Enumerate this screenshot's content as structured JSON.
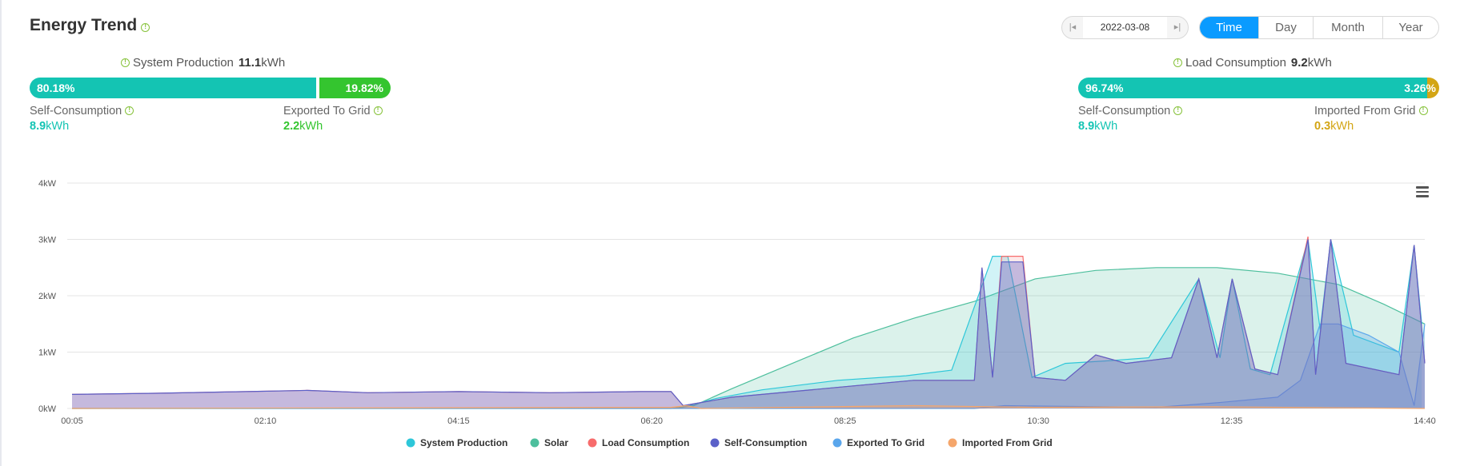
{
  "header": {
    "title": "Energy Trend"
  },
  "controls": {
    "date": "2022-03-08",
    "ranges": [
      {
        "label": "Time",
        "active": true
      },
      {
        "label": "Day",
        "active": false
      },
      {
        "label": "Month",
        "active": false
      },
      {
        "label": "Year",
        "active": false
      }
    ]
  },
  "production": {
    "title": "System Production",
    "total": "11.1",
    "unit": "kWh",
    "self_pct": "80.18%",
    "export_pct": "19.82%",
    "self_fraction": 0.8018,
    "self_label": "Self-Consumption",
    "self_value": "8.9",
    "export_label": "Exported To Grid",
    "export_value": "2.2"
  },
  "consumption": {
    "title": "Load Consumption",
    "total": "9.2",
    "unit": "kWh",
    "self_pct": "96.74%",
    "import_pct": "3.26%",
    "self_fraction": 0.9674,
    "self_label": "Self-Consumption",
    "self_value": "8.9",
    "import_label": "Imported From Grid",
    "import_value": "0.3"
  },
  "colors": {
    "teal": "#14c4b3",
    "green": "#34c52f",
    "gold": "#d3a515",
    "accent_blue": "#0a9bff",
    "info_green": "#86c23a"
  },
  "chart_data": {
    "type": "area",
    "x_ticks": [
      "00:05",
      "02:10",
      "04:15",
      "06:20",
      "08:25",
      "10:30",
      "12:35",
      "14:40"
    ],
    "x_minutes_range": [
      5,
      897
    ],
    "y_ticks": [
      "0kW",
      "1kW",
      "2kW",
      "3kW",
      "4kW"
    ],
    "ylim": [
      0,
      4
    ],
    "grid": true,
    "legend_position": "bottom",
    "series": [
      {
        "name": "System Production",
        "color": "#2ec7d9",
        "points": [
          [
            405,
            0
          ],
          [
            430,
            0.18
          ],
          [
            460,
            0.33
          ],
          [
            510,
            0.5
          ],
          [
            555,
            0.58
          ],
          [
            585,
            0.68
          ],
          [
            612,
            2.7
          ],
          [
            622,
            2.7
          ],
          [
            638,
            0.55
          ],
          [
            660,
            0.8
          ],
          [
            690,
            0.85
          ],
          [
            715,
            0.9
          ],
          [
            748,
            2.3
          ],
          [
            762,
            0.9
          ],
          [
            770,
            2.3
          ],
          [
            782,
            0.7
          ],
          [
            795,
            0.6
          ],
          [
            820,
            3.0
          ],
          [
            828,
            1.4
          ],
          [
            835,
            3.0
          ],
          [
            850,
            1.3
          ],
          [
            880,
            1.0
          ],
          [
            890,
            2.9
          ],
          [
            895,
            1.5
          ]
        ]
      },
      {
        "name": "Solar",
        "color": "#4dbf9d",
        "points": [
          [
            5,
            0
          ],
          [
            400,
            0
          ],
          [
            415,
            0.05
          ],
          [
            440,
            0.35
          ],
          [
            480,
            0.8
          ],
          [
            520,
            1.25
          ],
          [
            560,
            1.6
          ],
          [
            600,
            1.9
          ],
          [
            640,
            2.3
          ],
          [
            680,
            2.45
          ],
          [
            720,
            2.5
          ],
          [
            760,
            2.5
          ],
          [
            800,
            2.4
          ],
          [
            840,
            2.2
          ],
          [
            870,
            1.85
          ],
          [
            897,
            1.5
          ]
        ]
      },
      {
        "name": "Load Consumption",
        "color": "#f76c6c",
        "points": [
          [
            5,
            0.25
          ],
          [
            60,
            0.27
          ],
          [
            120,
            0.3
          ],
          [
            160,
            0.32
          ],
          [
            200,
            0.28
          ],
          [
            260,
            0.3
          ],
          [
            320,
            0.28
          ],
          [
            380,
            0.3
          ],
          [
            400,
            0.3
          ],
          [
            408,
            0.05
          ],
          [
            440,
            0.2
          ],
          [
            480,
            0.3
          ],
          [
            520,
            0.4
          ],
          [
            560,
            0.5
          ],
          [
            600,
            0.5
          ],
          [
            605,
            2.5
          ],
          [
            612,
            0.55
          ],
          [
            618,
            2.7
          ],
          [
            632,
            2.7
          ],
          [
            640,
            0.55
          ],
          [
            660,
            0.5
          ],
          [
            680,
            0.95
          ],
          [
            700,
            0.8
          ],
          [
            730,
            0.9
          ],
          [
            748,
            2.3
          ],
          [
            760,
            0.9
          ],
          [
            770,
            2.3
          ],
          [
            785,
            0.7
          ],
          [
            800,
            0.6
          ],
          [
            820,
            3.05
          ],
          [
            825,
            0.6
          ],
          [
            835,
            3.0
          ],
          [
            845,
            0.8
          ],
          [
            880,
            0.6
          ],
          [
            890,
            2.9
          ],
          [
            897,
            0.8
          ]
        ]
      },
      {
        "name": "Self-Consumption",
        "color": "#5b61c9",
        "points": [
          [
            5,
            0.25
          ],
          [
            60,
            0.27
          ],
          [
            120,
            0.3
          ],
          [
            160,
            0.32
          ],
          [
            200,
            0.28
          ],
          [
            260,
            0.3
          ],
          [
            320,
            0.28
          ],
          [
            380,
            0.3
          ],
          [
            400,
            0.3
          ],
          [
            408,
            0.05
          ],
          [
            440,
            0.2
          ],
          [
            480,
            0.3
          ],
          [
            520,
            0.4
          ],
          [
            560,
            0.5
          ],
          [
            600,
            0.5
          ],
          [
            605,
            2.5
          ],
          [
            612,
            0.55
          ],
          [
            618,
            2.6
          ],
          [
            632,
            2.6
          ],
          [
            640,
            0.55
          ],
          [
            660,
            0.5
          ],
          [
            680,
            0.95
          ],
          [
            700,
            0.8
          ],
          [
            730,
            0.9
          ],
          [
            748,
            2.3
          ],
          [
            760,
            0.9
          ],
          [
            770,
            2.3
          ],
          [
            785,
            0.7
          ],
          [
            800,
            0.6
          ],
          [
            820,
            3.0
          ],
          [
            825,
            0.6
          ],
          [
            835,
            3.0
          ],
          [
            845,
            0.8
          ],
          [
            880,
            0.6
          ],
          [
            890,
            2.9
          ],
          [
            897,
            0.8
          ]
        ]
      },
      {
        "name": "Exported To Grid",
        "color": "#5aa6ec",
        "points": [
          [
            5,
            0
          ],
          [
            600,
            0
          ],
          [
            620,
            0.05
          ],
          [
            720,
            0.02
          ],
          [
            760,
            0.1
          ],
          [
            800,
            0.2
          ],
          [
            815,
            0.5
          ],
          [
            828,
            1.5
          ],
          [
            840,
            1.5
          ],
          [
            860,
            1.3
          ],
          [
            880,
            1.0
          ],
          [
            890,
            0.05
          ],
          [
            897,
            1.5
          ]
        ]
      },
      {
        "name": "Imported From Grid",
        "color": "#f5a66b",
        "points": [
          [
            5,
            0
          ],
          [
            400,
            0.02
          ],
          [
            410,
            0.05
          ],
          [
            420,
            0
          ],
          [
            560,
            0.05
          ],
          [
            640,
            0.02
          ],
          [
            760,
            0.03
          ],
          [
            897,
            0
          ]
        ]
      }
    ]
  }
}
